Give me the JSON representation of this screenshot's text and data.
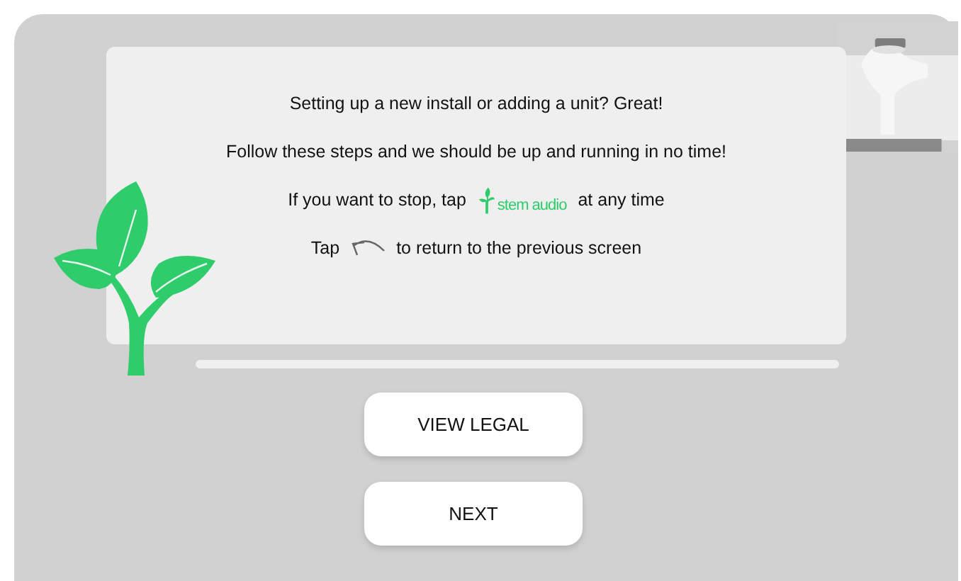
{
  "intro": {
    "lines": [
      {
        "kind": "text",
        "text": "Setting up a new install or adding a unit? Great!"
      },
      {
        "kind": "text",
        "text": "Follow these steps and we should be up and running in no time!"
      },
      {
        "kind": "logo",
        "before": "If you want to stop, tap",
        "logo": "stem audio",
        "after": "at any time"
      },
      {
        "kind": "back",
        "before": "Tap",
        "after": "to return to the previous screen"
      }
    ]
  },
  "buttons": [
    {
      "label": "VIEW LEGAL"
    },
    {
      "label": "NEXT"
    }
  ]
}
